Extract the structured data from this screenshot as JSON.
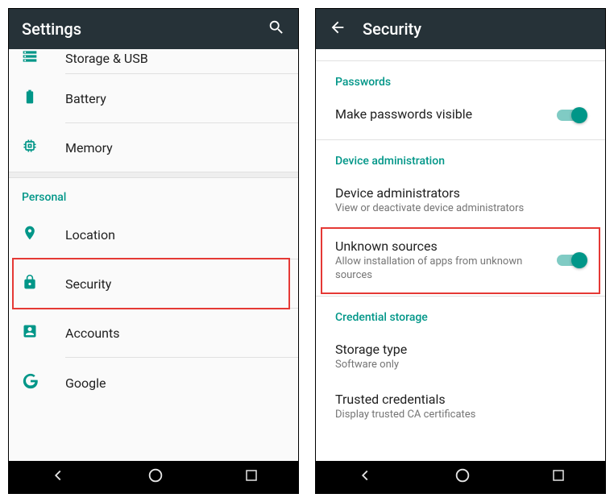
{
  "left": {
    "header": {
      "title": "Settings"
    },
    "items": {
      "storage": "Storage & USB",
      "battery": "Battery",
      "memory": "Memory"
    },
    "sections": {
      "personal": "Personal"
    },
    "personal_items": {
      "location": "Location",
      "security": "Security",
      "accounts": "Accounts",
      "google": "Google"
    }
  },
  "right": {
    "header": {
      "title": "Security"
    },
    "sections": {
      "passwords": "Passwords",
      "device_admin": "Device administration",
      "credential": "Credential storage"
    },
    "items": {
      "make_passwords": {
        "title": "Make passwords visible"
      },
      "device_admins": {
        "title": "Device administrators",
        "subtitle": "View or deactivate device administrators"
      },
      "unknown_sources": {
        "title": "Unknown sources",
        "subtitle": "Allow installation of apps from unknown sources"
      },
      "storage_type": {
        "title": "Storage type",
        "subtitle": "Software only"
      },
      "trusted_creds": {
        "title": "Trusted credentials",
        "subtitle": "Display trusted CA certificates"
      }
    }
  }
}
